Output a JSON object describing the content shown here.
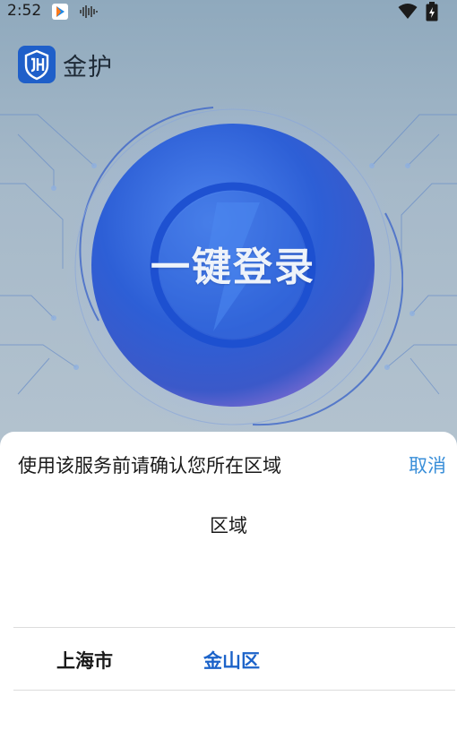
{
  "status_bar": {
    "time": "2:52",
    "icons": [
      "app-notification-icon",
      "sound-wave-icon",
      "wifi-icon",
      "battery-charging-icon"
    ]
  },
  "app": {
    "logo_icon": "jh-shield-logo-icon",
    "name": "金护"
  },
  "login": {
    "label": "一键登录",
    "icon": "lightning-bolt-icon"
  },
  "region_sheet": {
    "title": "使用该服务前请确认您所在区域",
    "cancel_label": "取消",
    "picker_heading": "区域",
    "city": "上海市",
    "district": "金山区"
  },
  "colors": {
    "accent_blue": "#3a8fd9",
    "selected_blue": "#1c63c9",
    "orb_blue": "#2f5fd8"
  }
}
